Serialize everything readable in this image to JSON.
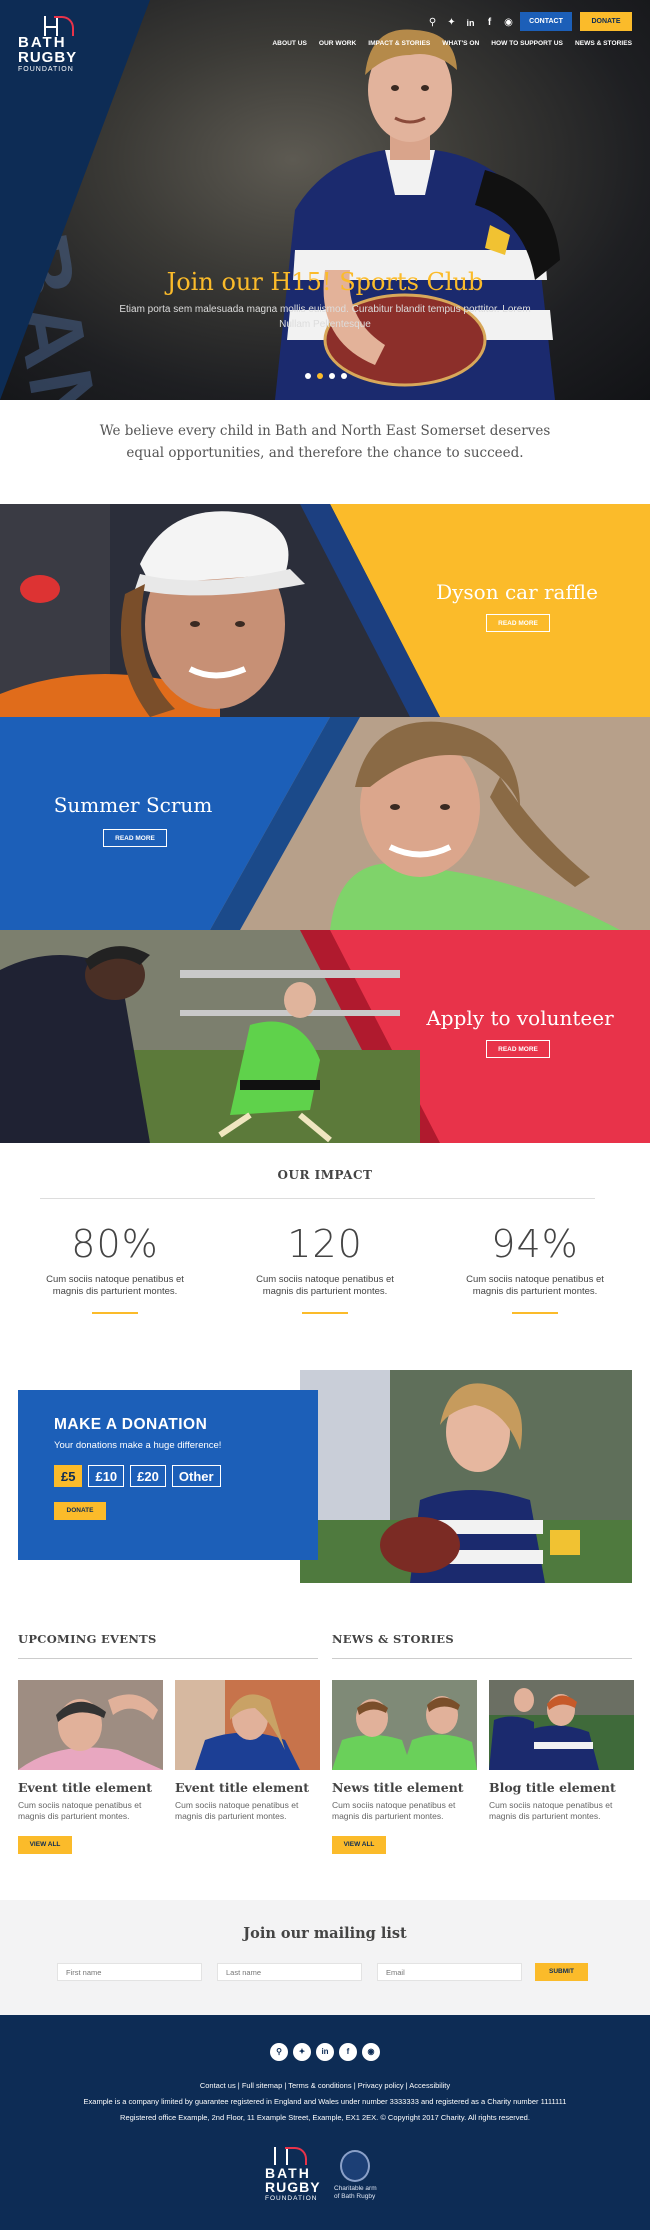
{
  "header": {
    "logo": {
      "line1": "BATH",
      "line2": "RUGBY",
      "line3": "FOUNDATION"
    },
    "social_icons": [
      "search-icon",
      "twitter-icon",
      "linkedin-icon",
      "facebook-icon",
      "instagram-icon"
    ],
    "contact_label": "CONTACT",
    "donate_label": "DONATE",
    "nav": [
      "ABOUT US",
      "OUR WORK",
      "IMPACT & STORIES",
      "WHAT'S ON",
      "HOW TO SUPPORT US",
      "NEWS & STORIES"
    ]
  },
  "hero": {
    "title": "Join our H15! Sports Club",
    "subtitle": "Etiam porta sem malesuada magna mollis euismod. Curabitur blandit tempus porttitor. Lorem Nullam Pellentesque",
    "background_text": "URBAN",
    "slides": 4,
    "active_slide": 2
  },
  "mission": "We believe every child in Bath and North East Somerset deserves equal opportunities, and therefore the chance to succeed.",
  "panels": [
    {
      "title": "Dyson car raffle",
      "button": "READ MORE",
      "color": "#fbbb2a"
    },
    {
      "title": "Summer Scrum",
      "button": "READ MORE",
      "color": "#1c5fb8"
    },
    {
      "title": "Apply to volunteer",
      "button": "READ MORE",
      "color": "#e8334a"
    }
  ],
  "impact": {
    "heading": "OUR IMPACT",
    "stats": [
      {
        "value": "80%",
        "text": "Cum sociis natoque penatibus et magnis dis parturient montes."
      },
      {
        "value": "120",
        "text": "Cum sociis natoque penatibus et magnis dis parturient montes."
      },
      {
        "value": "94%",
        "text": "Cum sociis natoque penatibus et magnis dis parturient montes."
      }
    ]
  },
  "donation": {
    "heading": "MAKE A DONATION",
    "text": "Your donations make a huge difference!",
    "amounts": [
      "£5",
      "£10",
      "£20",
      "Other"
    ],
    "selected": "£5",
    "button": "DONATE"
  },
  "events": {
    "heading": "UPCOMING EVENTS",
    "cards": [
      {
        "title": "Event title element",
        "text": "Cum sociis natoque penatibus et magnis dis parturient montes."
      },
      {
        "title": "Event title element",
        "text": "Cum sociis natoque penatibus et magnis dis parturient montes."
      }
    ],
    "button": "VIEW ALL"
  },
  "news": {
    "heading": "NEWS & STORIES",
    "cards": [
      {
        "title": "News title element",
        "text": "Cum sociis natoque penatibus et magnis dis parturient montes."
      },
      {
        "title": "Blog title element",
        "text": "Cum sociis natoque penatibus et magnis dis parturient montes."
      }
    ],
    "button": "VIEW ALL"
  },
  "mailing": {
    "heading": "Join our mailing list",
    "first_name_placeholder": "First name",
    "last_name_placeholder": "Last name",
    "email_placeholder": "Email",
    "submit": "SUBMIT"
  },
  "footer": {
    "links": [
      "Contact us",
      "Full sitemap",
      "Terms & conditions",
      "Privacy policy",
      "Accessibility"
    ],
    "legal1": "Example is a company limited by guarantee registered in England and Wales under number 3333333 and registered as a Charity number 1111111",
    "legal2": "Registered office Example, 2nd Floor, 11 Example Street, Example, EX1 2EX. © Copyright 2017 Charity. All rights reserved.",
    "charity_line1": "Charitable arm",
    "charity_line2": "of Bath Rugby",
    "logo": {
      "line1": "BATH",
      "line2": "RUGBY",
      "line3": "FOUNDATION"
    }
  },
  "colors": {
    "navy": "#0d2c55",
    "blue": "#1c5fb8",
    "yellow": "#fbbb2a",
    "red": "#e8334a"
  }
}
